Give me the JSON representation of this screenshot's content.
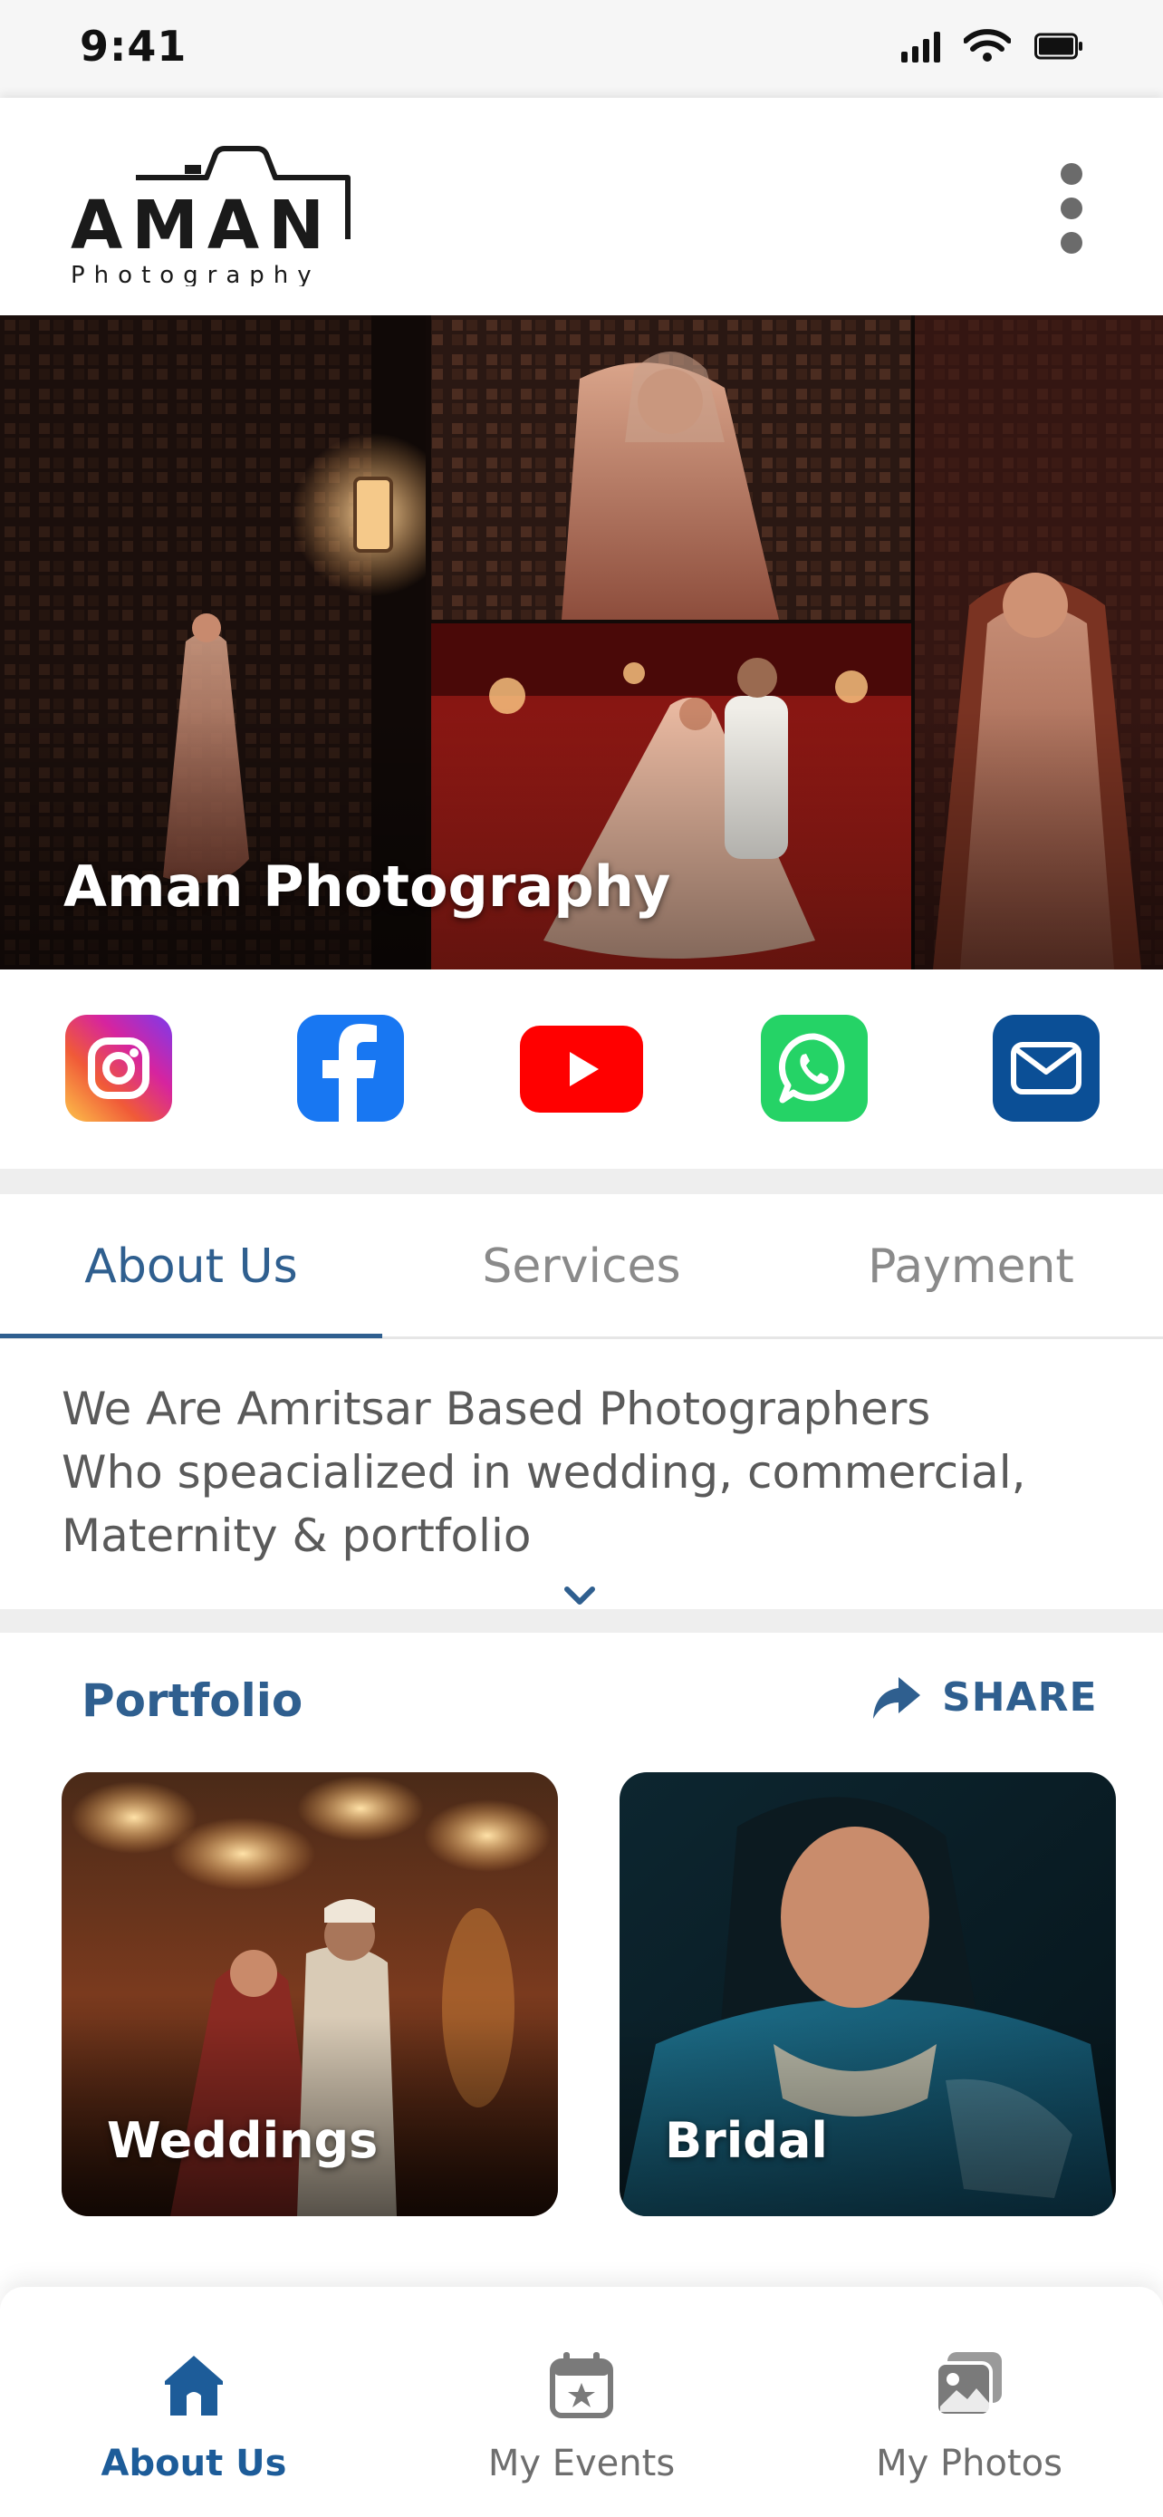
{
  "status_bar": {
    "time": "9:41"
  },
  "header": {
    "logo_main": "AMAN",
    "logo_sub": "Photography"
  },
  "hero": {
    "title": "Aman Photography"
  },
  "social": [
    "instagram-icon",
    "facebook-icon",
    "youtube-icon",
    "whatsapp-icon",
    "email-icon"
  ],
  "tabs": [
    {
      "label": "About Us",
      "active": true
    },
    {
      "label": "Services",
      "active": false
    },
    {
      "label": "Payment",
      "active": false
    }
  ],
  "about": {
    "lines": [
      "We Are Amritsar Based Photographers",
      "Who speacialized in wedding, commercial,",
      "Maternity & portfolio"
    ]
  },
  "portfolio": {
    "title": "Portfolio",
    "share_label": "SHARE",
    "cards": [
      {
        "label": "Weddings"
      },
      {
        "label": "Bridal"
      }
    ]
  },
  "bottom_nav": [
    {
      "label": "About Us",
      "icon": "home-icon",
      "active": true
    },
    {
      "label": "My Events",
      "icon": "calendar-icon",
      "active": false
    },
    {
      "label": "My Photos",
      "icon": "photos-icon",
      "active": false
    }
  ],
  "colors": {
    "primary": "#2f5f8f",
    "nav_active": "#1d5c99",
    "instagram": "#d6249f",
    "facebook": "#1877f2",
    "youtube": "#ff0000",
    "whatsapp": "#25d366",
    "email": "#0b4f96"
  }
}
